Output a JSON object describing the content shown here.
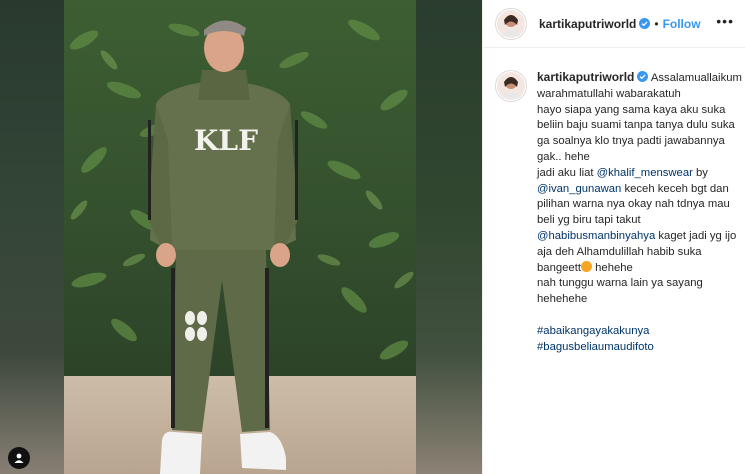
{
  "post": {
    "username": "kartikaputriworld",
    "follow_label": "Follow",
    "more_label": "•••",
    "dot": "•"
  },
  "caption": {
    "username": "kartikaputriworld",
    "line1": " Assalamuallaikum warahmatullahi wabarakatuh",
    "line2": "hayo siapa yang sama kaya aku suka beliin baju suami tanpa tanya dulu suka ga soalnya klo tnya padti jawabannya gak.. hehe",
    "line3_pre": "jadi aku liat ",
    "mention1": "@khalif_menswear",
    "line3_mid": " by",
    "mention2": "@ivan_gunawan",
    "line4": " keceh keceh bgt dan pilihan warna nya okay nah tdnya mau beli yg biru tapi takut",
    "mention3": "@habibusmanbinyahya",
    "line5": " kaget jadi yg ijo aja deh Alhamdulillah habib suka bangeett",
    "line5_end": " hehehe",
    "line6": "nah tunggu warna lain ya sayang hehehehe",
    "hashtag1": "#abaikangayakakunya",
    "hashtag2": "#bagusbeliaumaudifoto"
  },
  "photo": {
    "hoodie_text": "KLF",
    "colors": {
      "outfit": "#5f6b48",
      "foliage": "#3c5a35",
      "ground": "#c9b8a3"
    }
  }
}
